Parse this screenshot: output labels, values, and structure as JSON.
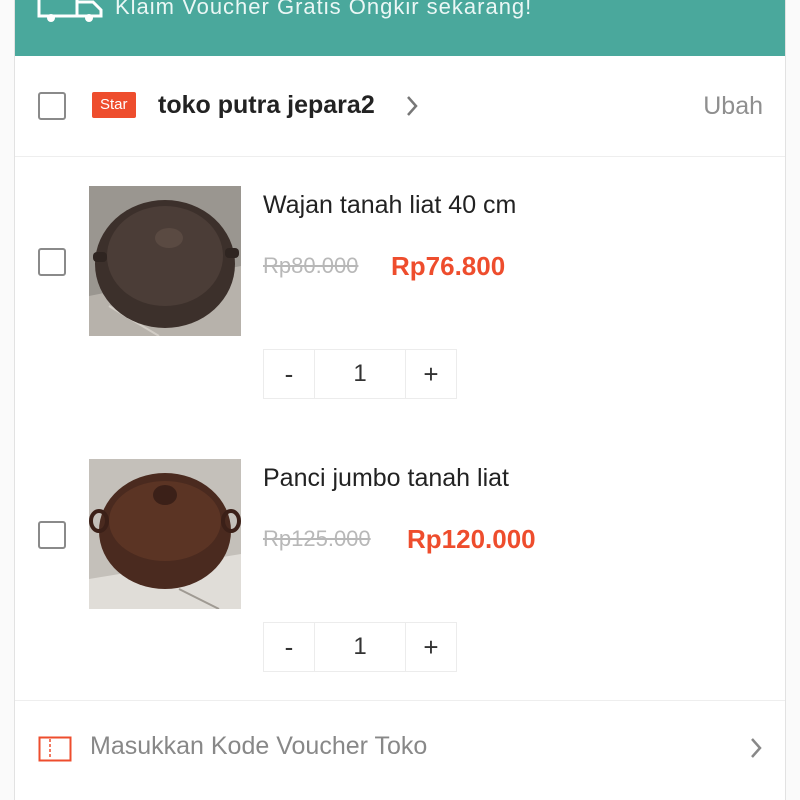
{
  "banner": {
    "text": "Klaim Voucher Gratis Ongkir sekarang!"
  },
  "shop": {
    "badge": "Star",
    "name": "toko putra jepara2",
    "edit_label": "Ubah"
  },
  "products": [
    {
      "name": "Wajan tanah liat 40 cm",
      "original_price": "Rp80.000",
      "price": "Rp76.800",
      "quantity": "1"
    },
    {
      "name": "Panci jumbo tanah liat",
      "original_price": "Rp125.000",
      "price": "Rp120.000",
      "quantity": "1"
    }
  ],
  "stepper": {
    "minus_label": "-",
    "plus_label": "+"
  },
  "voucher": {
    "label": "Masukkan Kode Voucher Toko"
  },
  "colors": {
    "banner": "#4aa89c",
    "accent": "#ee4d2d",
    "muted": "#888888"
  },
  "icons": {
    "banner": "truck-icon",
    "shop": "chevron-right-icon",
    "voucher": "voucher-ticket-icon",
    "voucher_action": "chevron-right-icon"
  }
}
